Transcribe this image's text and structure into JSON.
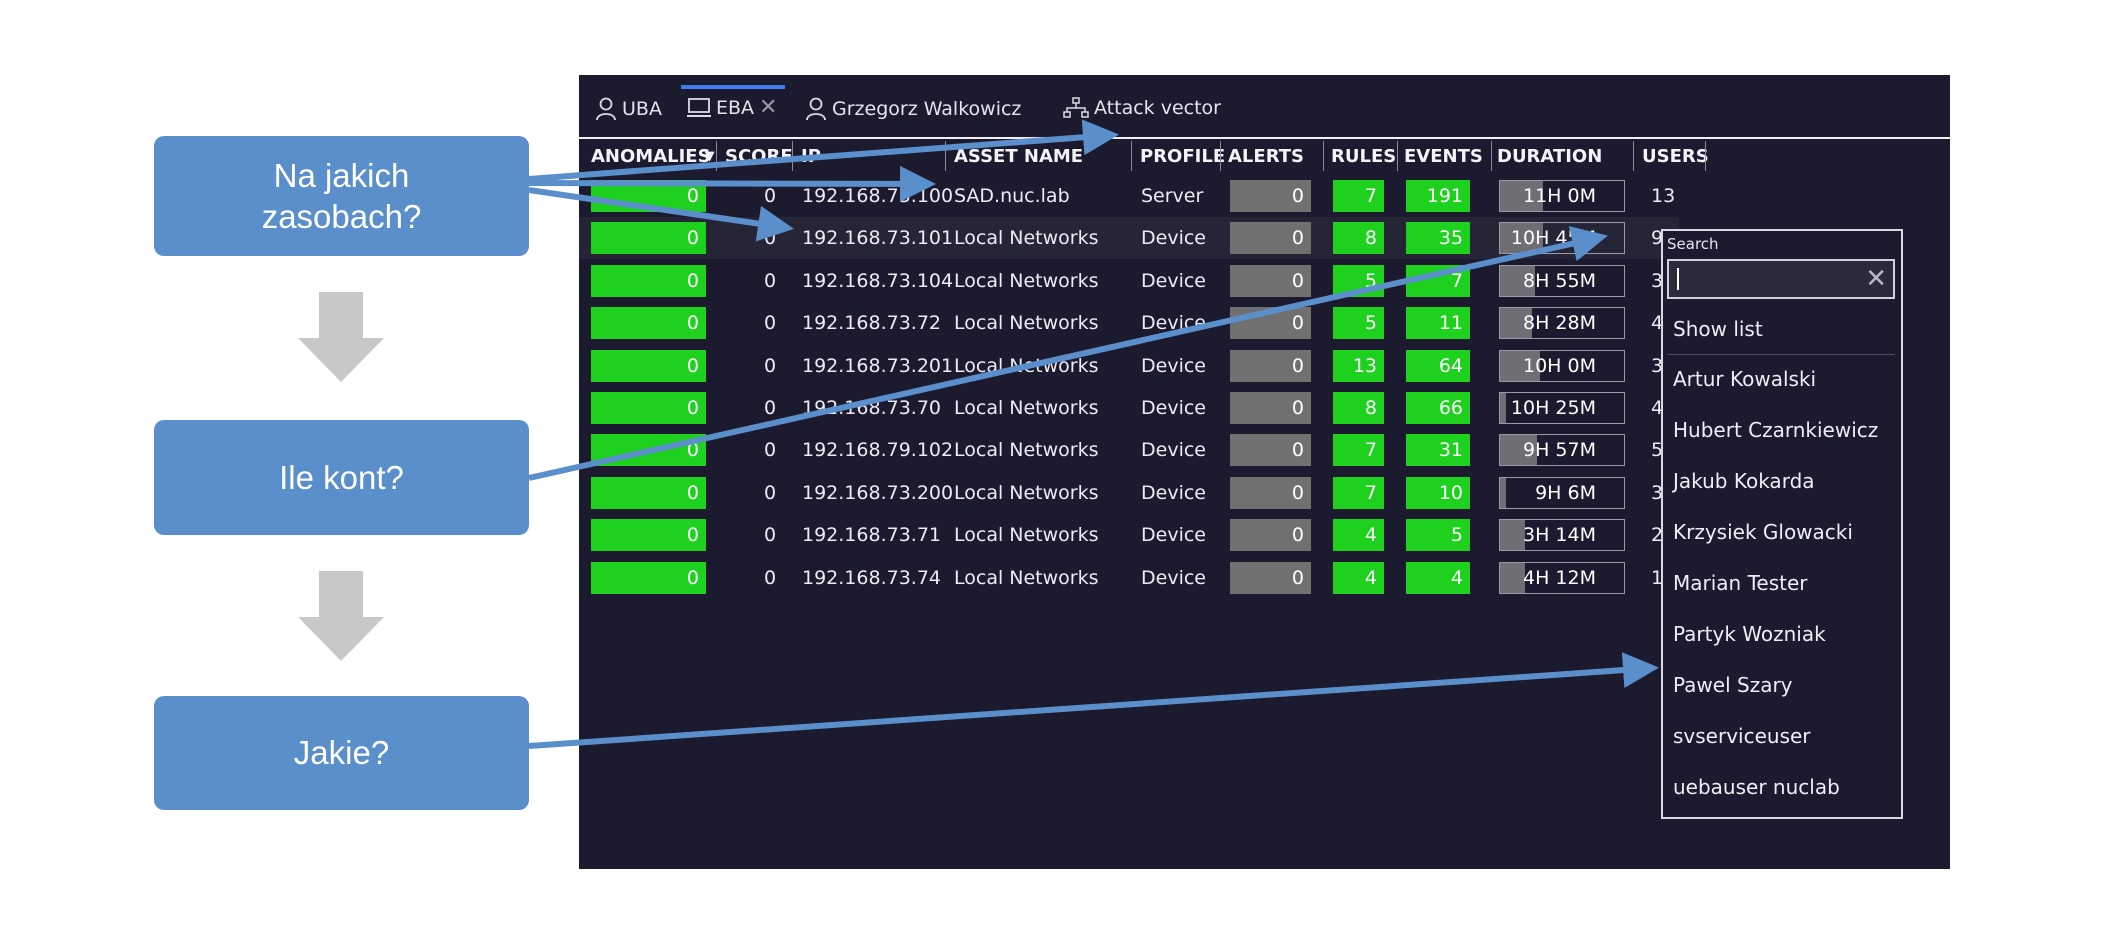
{
  "callouts": {
    "resources": "Na jakich\nzasobach?",
    "accounts": "Ile kont?",
    "which": "Jakie?"
  },
  "tabs": [
    {
      "label": "UBA",
      "icon": "user-icon"
    },
    {
      "label": "EBA",
      "icon": "monitor-icon",
      "closable": true
    },
    {
      "label": "Grzegorz Walkowicz",
      "icon": "user-icon"
    },
    {
      "label": "Attack vector",
      "icon": "network-icon"
    }
  ],
  "headers": {
    "anomalies": "ANOMALIES",
    "score": "SCORE",
    "ip": "IP",
    "asset_name": "ASSET NAME",
    "profile": "PROFILE",
    "alerts": "ALERTS",
    "rules": "RULES",
    "events": "EVENTS",
    "duration": "DURATION",
    "users": "USERS"
  },
  "rows": [
    {
      "anomalies": "0",
      "score": "0",
      "ip": "192.168.73.100",
      "asset": "SAD.nuc.lab",
      "profile": "Server",
      "alerts": "0",
      "rules": "7",
      "events": "191",
      "duration": "11H 0M",
      "duration_fill": 0.35,
      "users": "13"
    },
    {
      "anomalies": "0",
      "score": "0",
      "ip": "192.168.73.101",
      "asset": "Local Networks",
      "profile": "Device",
      "alerts": "0",
      "rules": "8",
      "events": "35",
      "duration": "10H 45M",
      "duration_fill": 0.35,
      "users": "9"
    },
    {
      "anomalies": "0",
      "score": "0",
      "ip": "192.168.73.104",
      "asset": "Local Networks",
      "profile": "Device",
      "alerts": "0",
      "rules": "5",
      "events": "7",
      "duration": "8H 55M",
      "duration_fill": 0.28,
      "users": "3"
    },
    {
      "anomalies": "0",
      "score": "0",
      "ip": "192.168.73.72",
      "asset": "Local Networks",
      "profile": "Device",
      "alerts": "0",
      "rules": "5",
      "events": "11",
      "duration": "8H 28M",
      "duration_fill": 0.26,
      "users": "4"
    },
    {
      "anomalies": "0",
      "score": "0",
      "ip": "192.168.73.201",
      "asset": "Local Networks",
      "profile": "Device",
      "alerts": "0",
      "rules": "13",
      "events": "64",
      "duration": "10H 0M",
      "duration_fill": 0.32,
      "users": "3"
    },
    {
      "anomalies": "0",
      "score": "0",
      "ip": "192.168.73.70",
      "asset": "Local Networks",
      "profile": "Device",
      "alerts": "0",
      "rules": "8",
      "events": "66",
      "duration": "10H 25M",
      "duration_fill": 0.05,
      "users": "4"
    },
    {
      "anomalies": "0",
      "score": "0",
      "ip": "192.168.79.102",
      "asset": "Local Networks",
      "profile": "Device",
      "alerts": "0",
      "rules": "7",
      "events": "31",
      "duration": "9H 57M",
      "duration_fill": 0.3,
      "users": "5"
    },
    {
      "anomalies": "0",
      "score": "0",
      "ip": "192.168.73.200",
      "asset": "Local Networks",
      "profile": "Device",
      "alerts": "0",
      "rules": "7",
      "events": "10",
      "duration": "9H 6M",
      "duration_fill": 0.05,
      "users": "3"
    },
    {
      "anomalies": "0",
      "score": "0",
      "ip": "192.168.73.71",
      "asset": "Local Networks",
      "profile": "Device",
      "alerts": "0",
      "rules": "4",
      "events": "5",
      "duration": "3H 14M",
      "duration_fill": 0.2,
      "users": "2"
    },
    {
      "anomalies": "0",
      "score": "0",
      "ip": "192.168.73.74",
      "asset": "Local Networks",
      "profile": "Device",
      "alerts": "0",
      "rules": "4",
      "events": "4",
      "duration": "4H 12M",
      "duration_fill": 0.2,
      "users": "1"
    }
  ],
  "dropdown": {
    "label": "Search",
    "search_value": "",
    "show_list": "Show list",
    "users": [
      "Artur Kowalski",
      "Hubert Czarnkiewicz",
      "Jakub Kokarda",
      "Krzysiek Glowacki",
      "Marian Tester",
      "Partyk Wozniak",
      "Pawel Szary",
      "svserviceuser",
      "uebauser nuclab"
    ]
  },
  "colors": {
    "panel_bg": "#1b1a2e",
    "green": "#1ed11e",
    "gray": "#707070",
    "callout": "#5a8fcb",
    "arrow": "#5a8fcb",
    "tab_accent": "#3d7ff0"
  }
}
